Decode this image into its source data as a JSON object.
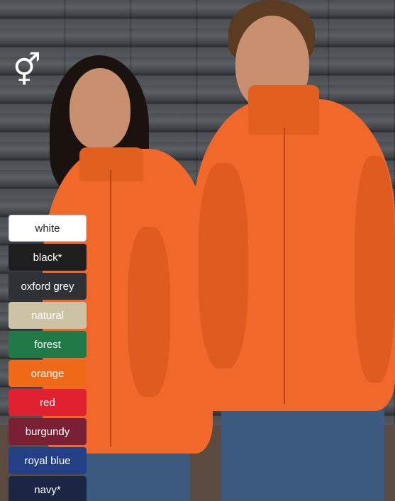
{
  "gender_symbol": "⚥",
  "swatches": [
    {
      "label": "white",
      "color": "#ffffff",
      "text_color": "#222222"
    },
    {
      "label": "black*",
      "color": "#1e1e1e",
      "text_color": "#ffffff"
    },
    {
      "label": "oxford grey",
      "color": "#2e3236",
      "text_color": "#ffffff"
    },
    {
      "label": "natural",
      "color": "#cbc3a4",
      "text_color": "#ffffff"
    },
    {
      "label": "forest",
      "color": "#1f7a47",
      "text_color": "#ffffff"
    },
    {
      "label": "orange",
      "color": "#ee6a17",
      "text_color": "#ffffff"
    },
    {
      "label": "red",
      "color": "#e0212f",
      "text_color": "#ffffff"
    },
    {
      "label": "burgundy",
      "color": "#7a2035",
      "text_color": "#ffffff"
    },
    {
      "label": "royal blue",
      "color": "#233f86",
      "text_color": "#ffffff"
    },
    {
      "label": "navy*",
      "color": "#1b2644",
      "text_color": "#ffffff"
    }
  ]
}
